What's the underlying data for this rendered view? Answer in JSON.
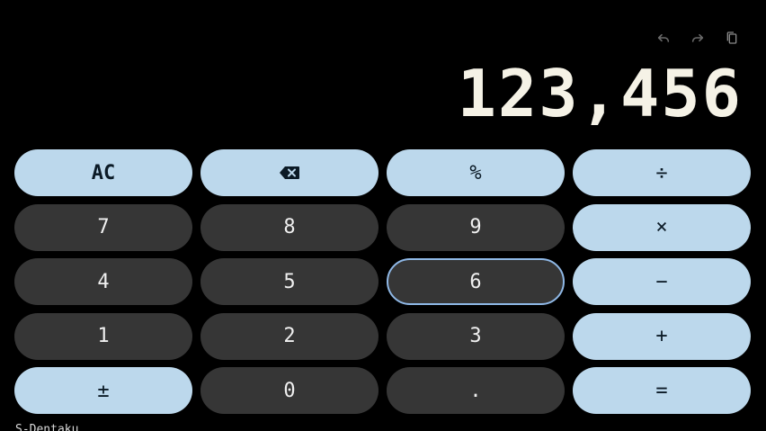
{
  "app": {
    "footer_label": "S-Dentaku"
  },
  "display": {
    "value": "123,456"
  },
  "toolbar": {
    "undo_icon": "undo-icon",
    "redo_icon": "redo-icon",
    "copy_icon": "copy-icon"
  },
  "keys": {
    "ac": "AC",
    "backspace_icon": "backspace-icon",
    "percent": "%",
    "divide": "÷",
    "seven": "7",
    "eight": "8",
    "nine": "9",
    "multiply": "×",
    "four": "4",
    "five": "5",
    "six": "6",
    "minus": "−",
    "one": "1",
    "two": "2",
    "three": "3",
    "plus": "+",
    "plus_minus": "±",
    "zero": "0",
    "decimal": ".",
    "equals": "="
  },
  "colors": {
    "background": "#000000",
    "light_key": "#bcd8ec",
    "dark_key": "#363636",
    "display_text": "#f5f2e6",
    "focus_ring": "#8fb8e6"
  }
}
